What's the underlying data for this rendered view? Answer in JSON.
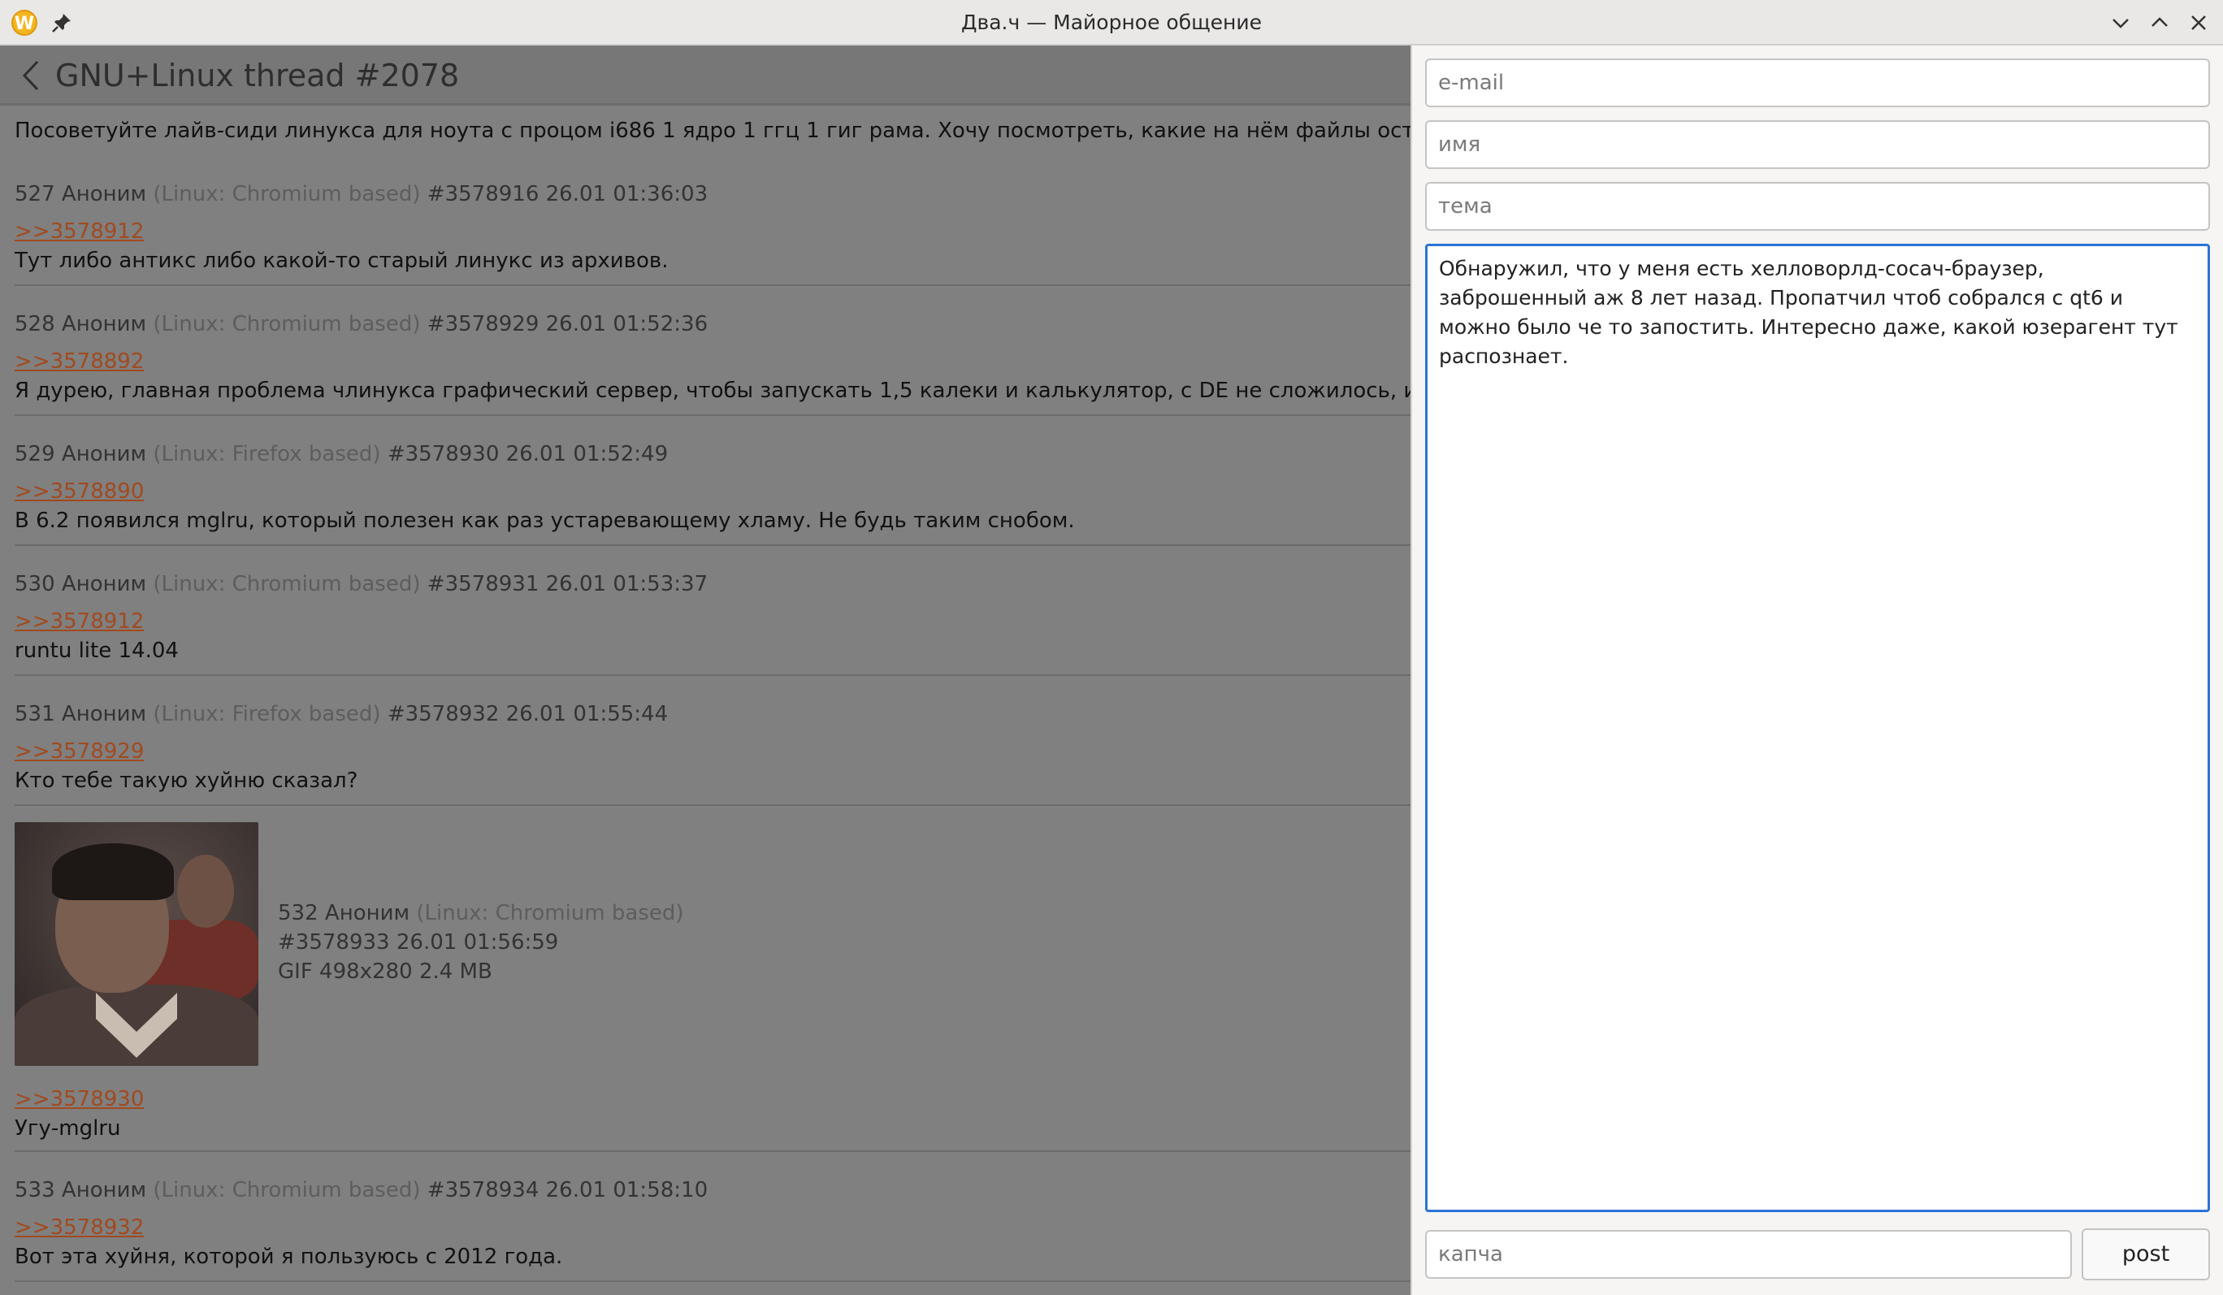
{
  "window": {
    "title": "Два.ч — Майорное общение",
    "app_icon_letter": "W"
  },
  "thread": {
    "title": "GNU+Linux thread #2078",
    "op_text": "Посоветуйте лайв-сиди линукса для ноута с процом i686 1 ядро 1 ггц 1 гиг рама. Хочу посмотреть, какие на нём файлы остались, потом",
    "posts": [
      {
        "num": "527",
        "author": "Аноним",
        "ua": "(Linux: Chromium based)",
        "id": "#3578916",
        "date": "26.01 01:36:03",
        "reply_to": ">>3578912",
        "text": "Тут либо антикс либо какой-то старый линукс из архивов."
      },
      {
        "num": "528",
        "author": "Аноним",
        "ua": "(Linux: Chromium based)",
        "id": "#3578929",
        "date": "26.01 01:52:36",
        "reply_to": ">>3578892",
        "text": "Я дурею, главная проблема члинукса графический сервер, чтобы запускать 1,5 калеки и калькулятор, с DE не сложилось, инит тоже гов"
      },
      {
        "num": "529",
        "author": "Аноним",
        "ua": "(Linux: Firefox based)",
        "id": "#3578930",
        "date": "26.01 01:52:49",
        "reply_to": ">>3578890",
        "text": "В 6.2 появился mglru, который полезен как раз устаревающему хламу. Не будь таким снобом."
      },
      {
        "num": "530",
        "author": "Аноним",
        "ua": "(Linux: Chromium based)",
        "id": "#3578931",
        "date": "26.01 01:53:37",
        "reply_to": ">>3578912",
        "text": "runtu lite 14.04"
      },
      {
        "num": "531",
        "author": "Аноним",
        "ua": "(Linux: Firefox based)",
        "id": "#3578932",
        "date": "26.01 01:55:44",
        "reply_to": ">>3578929",
        "text": "Кто тебе такую хуйню сказал?"
      },
      {
        "num": "532",
        "author": "Аноним",
        "ua": "(Linux: Chromium based)",
        "id": "#3578933",
        "date": "26.01 01:56:59",
        "file_info": "GIF 498x280 2.4 MB",
        "reply_to": ">>3578930",
        "text": "Угу-mglru"
      },
      {
        "num": "533",
        "author": "Аноним",
        "ua": "(Linux: Chromium based)",
        "id": "#3578934",
        "date": "26.01 01:58:10",
        "reply_to": ">>3578932",
        "text": "Вот эта хуйня, которой я пользуюсь с 2012 года."
      }
    ]
  },
  "form": {
    "email_placeholder": "e-mail",
    "name_placeholder": "имя",
    "subject_placeholder": "тема",
    "message": "Обнаружил, что у меня есть хелловорлд-сосач-браузер, заброшенный аж 8 лет назад. Пропатчил чтоб собрался с qt6 и можно было че то запостить. Интересно даже, какой юзерагент тут распознает.",
    "captcha_placeholder": "капча",
    "post_label": "post"
  },
  "colors": {
    "accent": "#2a74d6",
    "reply_link": "#a14a1f",
    "overlay_gray": "#808080"
  }
}
